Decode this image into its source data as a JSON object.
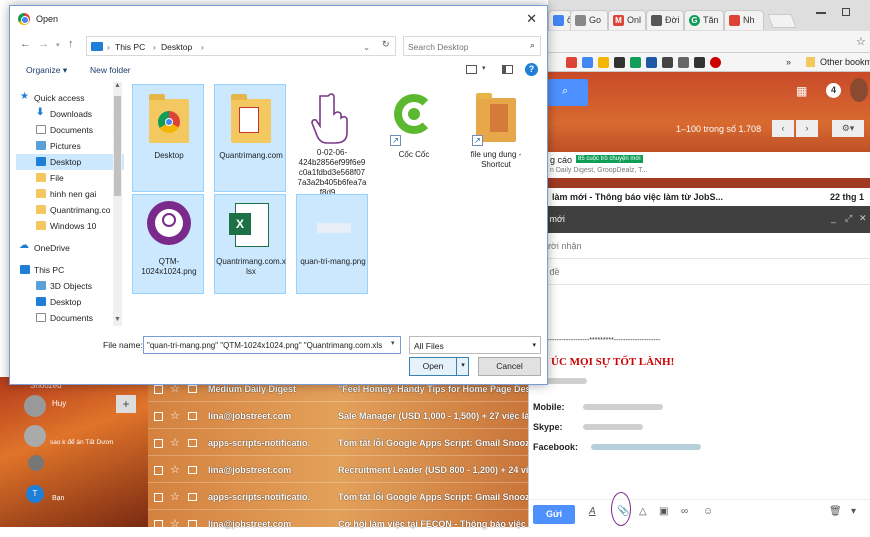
{
  "browser": {
    "tabs": [
      {
        "label": "ổn",
        "color": "#4285f4"
      },
      {
        "label": "Go",
        "color": "#888888"
      },
      {
        "label": "Onl",
        "color": "#db4437"
      },
      {
        "label": "Đời",
        "color": "#555555"
      },
      {
        "label": "Tăn",
        "color": "#0f9d58"
      },
      {
        "label": "Nh",
        "color": "#db4437"
      }
    ],
    "bookmarks_overflow": "»",
    "bookmark_other": "Other bookm"
  },
  "gmail": {
    "pagination": "1–100 trong số 1.708",
    "notification_count": "4",
    "promo_label": "g cáo",
    "promo_badge": "85 cuộc trò chuyện mới",
    "promo_snippet": "n Daily Digest, GroopDealz, T...",
    "top_email_subject": "làm mới - Thông báo việc làm từ JobS...",
    "top_email_date": "22 thg 1",
    "left_nav": {
      "snoozed": "Snoozed",
      "user_name": "Huy",
      "contact1": "sao k để ản Tất Dươn",
      "contact2": "Bạn"
    },
    "mail_rows": [
      {
        "sender": "Medium Daily Digest",
        "subject": "\"Feel Homey. Handy Tips for Home Page Des"
      },
      {
        "sender": "lina@jobstreet.com",
        "subject": "Sale Manager (USD 1,000 - 1,500) + 27 việc là"
      },
      {
        "sender": "apps-scripts-notificatio.",
        "subject": "Tóm tắt lỗi Google Apps Script: Gmail Snooz"
      },
      {
        "sender": "lina@jobstreet.com",
        "subject": "Recruitment Leader (USD 800 - 1,200) + 24 vi"
      },
      {
        "sender": "apps-scripts-notificatio.",
        "subject": "Tóm tắt lỗi Google Apps Script: Gmail Snooz"
      },
      {
        "sender": "lina@jobstreet.com",
        "subject": "Cơ hội làm việc tại FECON - Thông báo việc l"
      }
    ],
    "compose": {
      "title": "ư mới",
      "to_placeholder": "ười nhận",
      "subject_placeholder": "i đề",
      "separator": "-------------------*********--------------------",
      "greeting": "ÚC MỌI SỰ TỐT LÀNH!",
      "mobile_label": "Mobile:",
      "skype_label": "Skype:",
      "facebook_label": "Facebook:",
      "send_label": "Gửi"
    }
  },
  "dialog": {
    "title": "Open",
    "close_glyph": "✕",
    "breadcrumb": [
      "This PC",
      "Desktop"
    ],
    "search_placeholder": "Search Desktop",
    "organize_label": "Organize ▾",
    "new_folder_label": "New folder",
    "nav_items": [
      {
        "label": "Quick access",
        "icon": "star-icon",
        "color": "#1f7fd6",
        "pinned": false
      },
      {
        "label": "Downloads",
        "icon": "download-icon",
        "color": "#1f7fd6",
        "pinned": true
      },
      {
        "label": "Documents",
        "icon": "documents-icon",
        "color": "#8a8a8a",
        "pinned": true
      },
      {
        "label": "Pictures",
        "icon": "pictures-icon",
        "color": "#5aa0d8",
        "pinned": true
      },
      {
        "label": "Desktop",
        "icon": "desktop-icon",
        "color": "#1f7fd6",
        "pinned": true
      },
      {
        "label": "File",
        "icon": "folder-icon",
        "color": "#f3c860",
        "pinned": false
      },
      {
        "label": "hinh nen gai",
        "icon": "folder-icon",
        "color": "#f3c860",
        "pinned": false
      },
      {
        "label": "Quantrimang.co",
        "icon": "folder-icon",
        "color": "#f3c860",
        "pinned": false
      },
      {
        "label": "Windows 10",
        "icon": "folder-icon",
        "color": "#f3c860",
        "pinned": false
      },
      {
        "label": "OneDrive",
        "icon": "cloud-icon",
        "color": "#1f7fd6",
        "pinned": false
      },
      {
        "label": "This PC",
        "icon": "pc-icon",
        "color": "#1f7fd6",
        "pinned": false
      },
      {
        "label": "3D Objects",
        "icon": "cube-icon",
        "color": "#5aa0d8",
        "pinned": false
      },
      {
        "label": "Desktop",
        "icon": "desktop-icon",
        "color": "#1f7fd6",
        "pinned": false
      },
      {
        "label": "Documents",
        "icon": "documents-icon",
        "color": "#8a8a8a",
        "pinned": false
      }
    ],
    "files": [
      {
        "label": "Desktop",
        "kind": "folder-chrome",
        "selected": true
      },
      {
        "label": "Quantrimang.com",
        "kind": "folder-doc",
        "selected": true
      },
      {
        "label": "0-02-06-424b2856ef99f6e9c0a1fdbd3e568f077a3a2b405b6fea7af8d9....",
        "kind": "image-hand",
        "selected": false
      },
      {
        "label": "Cốc Cốc",
        "kind": "coccoc",
        "selected": false
      },
      {
        "label": "file ung dung - Shortcut",
        "kind": "folder-shortcut",
        "selected": false
      },
      {
        "label": "QTM-1024x1024.png",
        "kind": "png-bulb",
        "selected": true
      },
      {
        "label": "Quantrimang.com.xlsx",
        "kind": "excel",
        "selected": true
      },
      {
        "label": "quan-tri-mang.png",
        "kind": "png-blank",
        "selected": true
      }
    ],
    "filename_label": "File name:",
    "filename_value": "\"quan-tri-mang.png\" \"QTM-1024x1024.png\" \"Quantrimang.com.xls",
    "filter_value": "All Files",
    "open_label": "Open",
    "cancel_label": "Cancel"
  }
}
